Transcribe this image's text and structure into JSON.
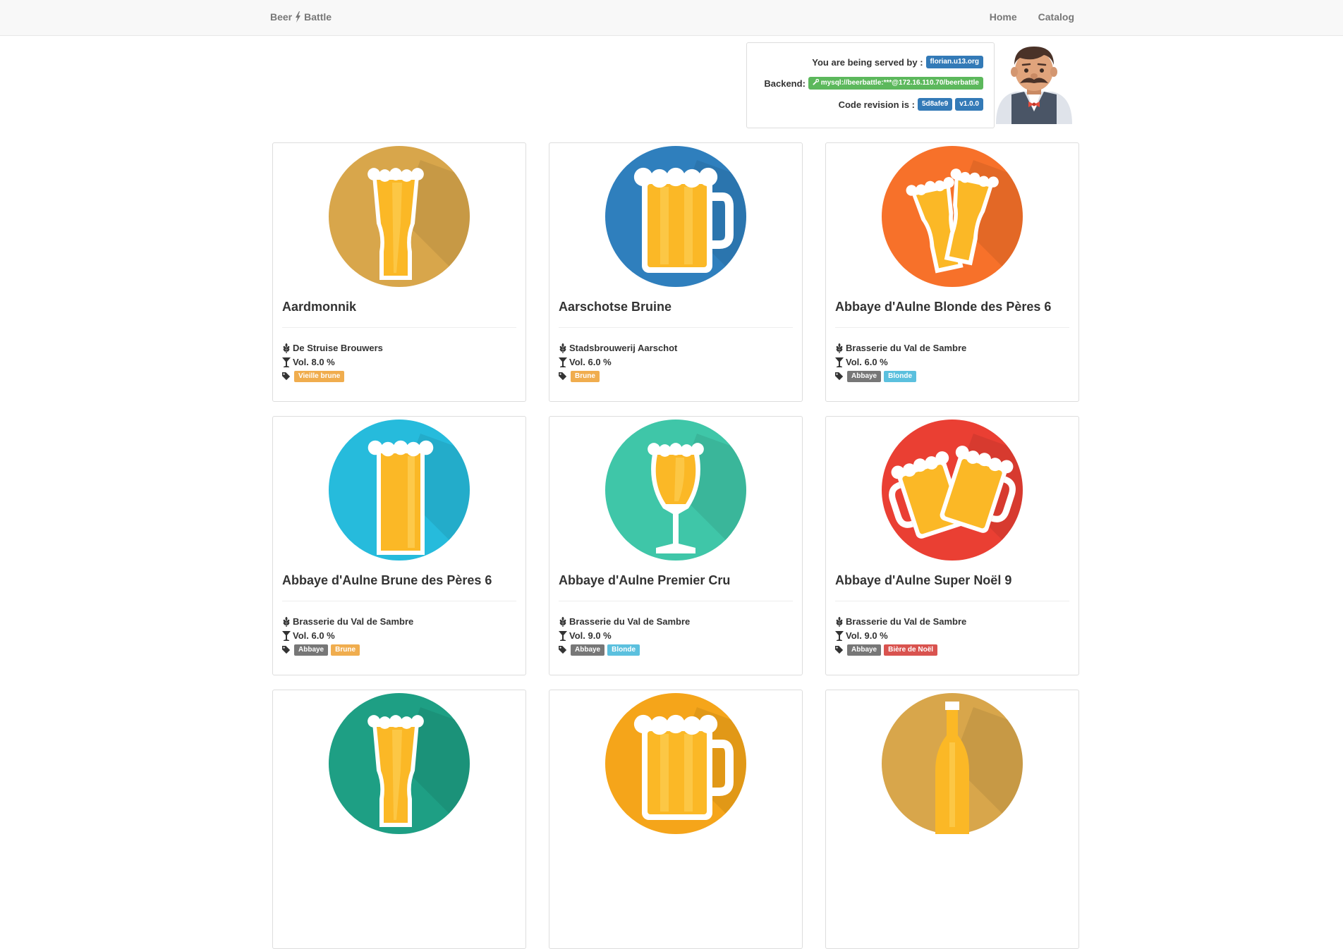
{
  "navbar": {
    "brand_left": "Beer",
    "brand_right": "Battle",
    "links": [
      "Home",
      "Catalog"
    ]
  },
  "server": {
    "served_label": "You are being served by :",
    "served_value": "florian.u13.org",
    "backend_label": "Backend:",
    "backend_value": "mysql://beerbattle:***@172.16.110.70/beerbattle",
    "revision_label": "Code revision is :",
    "revision_hash": "5d8afe9",
    "revision_version": "v1.0.0"
  },
  "tag_colors": {
    "Vieille brune": "#f0ad4e",
    "Brune": "#f0ad4e",
    "Abbaye": "#777777",
    "Blonde": "#5bc0de",
    "Bière de Noël": "#d9534f"
  },
  "beers": [
    {
      "name": "Aardmonnik",
      "brewery": "De Struise Brouwers",
      "vol": "Vol. 8.0 %",
      "tags": [
        "Vieille brune"
      ],
      "bg": "#d8a64b",
      "glass": "weizen"
    },
    {
      "name": "Aarschotse Bruine",
      "brewery": "Stadsbrouwerij Aarschot",
      "vol": "Vol. 6.0 %",
      "tags": [
        "Brune"
      ],
      "bg": "#2f7fbd",
      "glass": "mug"
    },
    {
      "name": "Abbaye d'Aulne Blonde des Pères 6",
      "brewery": "Brasserie du Val de Sambre",
      "vol": "Vol. 6.0 %",
      "tags": [
        "Abbaye",
        "Blonde"
      ],
      "bg": "#f7712a",
      "glass": "cheers"
    },
    {
      "name": "Abbaye d'Aulne Brune des Pères 6",
      "brewery": "Brasserie du Val de Sambre",
      "vol": "Vol. 6.0 %",
      "tags": [
        "Abbaye",
        "Brune"
      ],
      "bg": "#26bbdc",
      "glass": "pint"
    },
    {
      "name": "Abbaye d'Aulne Premier Cru",
      "brewery": "Brasserie du Val de Sambre",
      "vol": "Vol. 9.0 %",
      "tags": [
        "Abbaye",
        "Blonde"
      ],
      "bg": "#3fc6a8",
      "glass": "tulip"
    },
    {
      "name": "Abbaye d'Aulne Super Noël 9",
      "brewery": "Brasserie du Val de Sambre",
      "vol": "Vol. 9.0 %",
      "tags": [
        "Abbaye",
        "Bière de Noël"
      ],
      "bg": "#ea3f33",
      "glass": "mugs"
    },
    {
      "name": "",
      "brewery": "",
      "vol": "",
      "tags": [],
      "bg": "#1e9f84",
      "glass": "weizen"
    },
    {
      "name": "",
      "brewery": "",
      "vol": "",
      "tags": [],
      "bg": "#f5a51a",
      "glass": "mug"
    },
    {
      "name": "",
      "brewery": "",
      "vol": "",
      "tags": [],
      "bg": "#d8a64b",
      "glass": "bottle"
    }
  ]
}
